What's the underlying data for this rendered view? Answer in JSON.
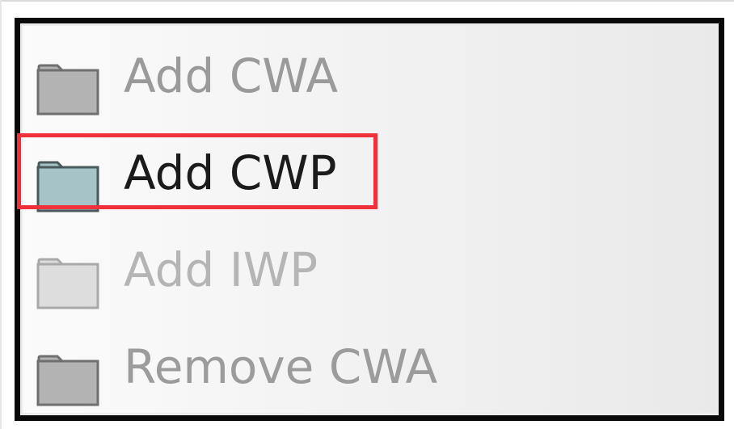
{
  "menu": {
    "items": [
      {
        "label": "Add CWA",
        "icon": "folder-icon",
        "icon_color": "#b3b3b3",
        "state": "disabled"
      },
      {
        "label": "Add CWP",
        "icon": "folder-icon",
        "icon_color": "#a6c4c7",
        "state": "enabled",
        "highlighted": true
      },
      {
        "label": "Add IWP",
        "icon": "folder-icon",
        "icon_color": "#dddddd",
        "state": "disabled"
      },
      {
        "label": "Remove CWA",
        "icon": "folder-icon",
        "icon_color": "#b3b3b3",
        "state": "disabled"
      }
    ]
  },
  "colors": {
    "highlight": "#f0313b",
    "menu_border": "#0a0a0a",
    "enabled_text": "#1b1b1b",
    "disabled_text": "#9a9a9a"
  }
}
